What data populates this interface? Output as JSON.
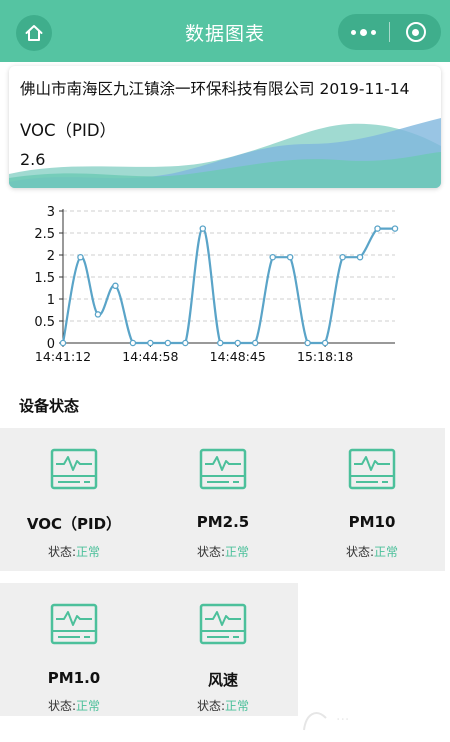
{
  "header": {
    "title": "数据图表"
  },
  "info": {
    "company": "佛山市南海区九江镇涂一环保科技有限公司",
    "date": "2019-11-14",
    "sensor_name": "VOC（PID）",
    "sensor_value": "2.6"
  },
  "colors": {
    "accent": "#55c4a2",
    "accent_dark": "#3fae8c",
    "status_ok": "#4cc09b",
    "line": "#5aa4c8"
  },
  "chart_data": {
    "type": "line",
    "x_tick_labels": [
      "14:41:12",
      "14:44:58",
      "14:48:45",
      "15:18:18"
    ],
    "ylim": [
      0,
      3
    ],
    "y_ticks": [
      "0",
      "0.5",
      "1",
      "1.5",
      "2",
      "2.5",
      "3"
    ],
    "values": [
      0,
      1.95,
      0.65,
      1.3,
      0,
      0,
      0,
      0,
      2.6,
      0,
      0,
      0,
      1.95,
      1.95,
      0,
      0,
      1.95,
      1.95,
      2.6,
      2.6
    ],
    "grid": true
  },
  "section": {
    "title": "设备状态"
  },
  "status_label": "状态:",
  "devices": [
    {
      "name": "VOC（PID）",
      "status": "正常"
    },
    {
      "name": "PM2.5",
      "status": "正常"
    },
    {
      "name": "PM10",
      "status": "正常"
    },
    {
      "name": "PM1.0",
      "status": "正常"
    },
    {
      "name": "风速",
      "status": "正常"
    }
  ]
}
